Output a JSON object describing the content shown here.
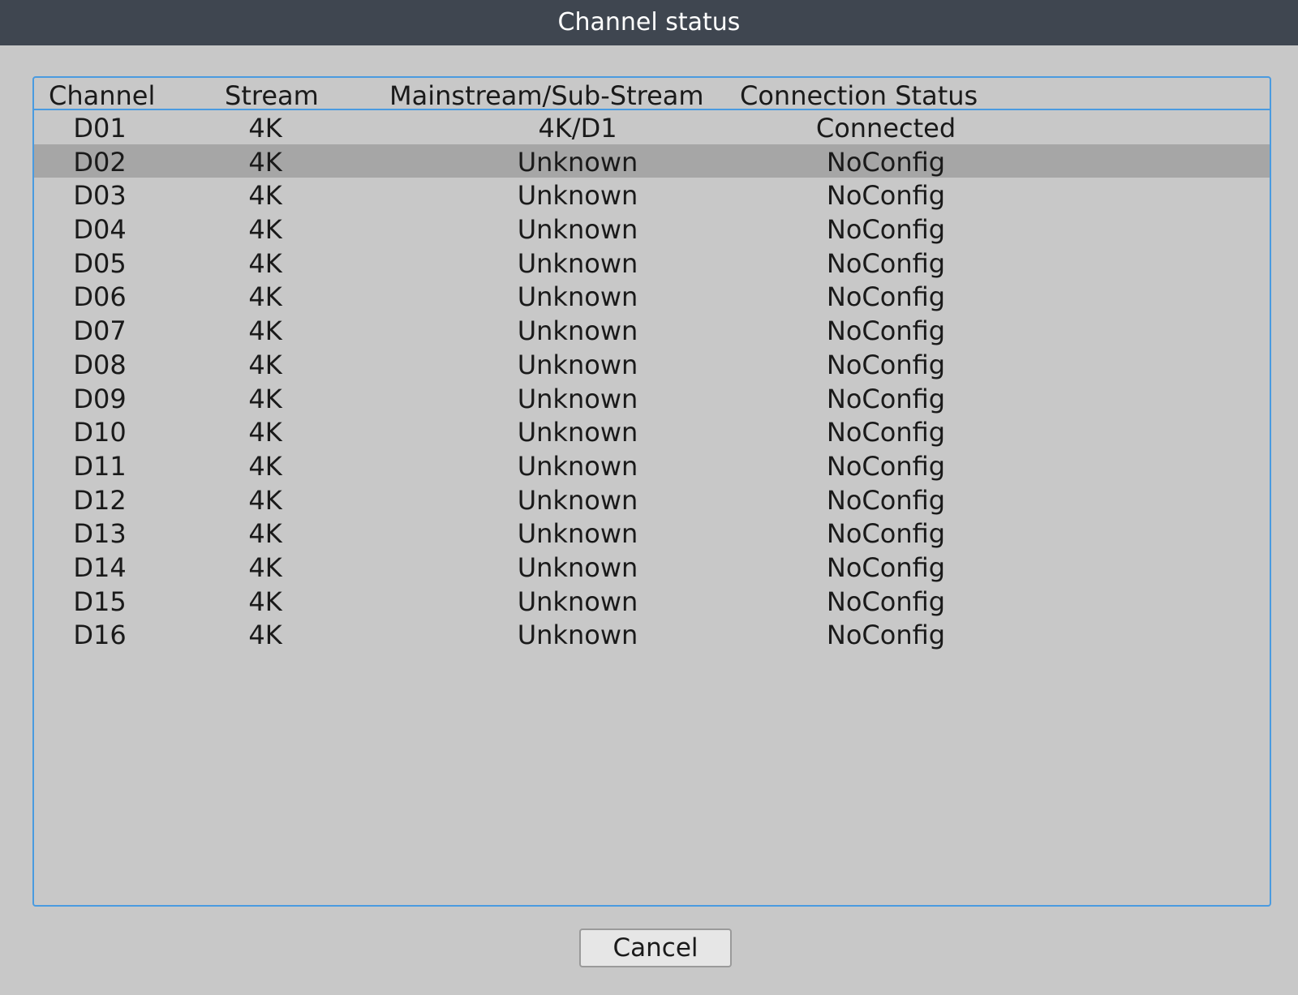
{
  "window": {
    "title": "Channel status"
  },
  "table": {
    "columns": {
      "channel": "Channel",
      "stream": "Stream",
      "mainstream_sub": "Mainstream/Sub-Stream",
      "connection_status": "Connection Status"
    },
    "selected_row": 1,
    "rows": [
      {
        "channel": "D01",
        "stream": "4K",
        "mainstream_sub": "4K/D1",
        "connection_status": "Connected"
      },
      {
        "channel": "D02",
        "stream": "4K",
        "mainstream_sub": "Unknown",
        "connection_status": "NoConfig"
      },
      {
        "channel": "D03",
        "stream": "4K",
        "mainstream_sub": "Unknown",
        "connection_status": "NoConfig"
      },
      {
        "channel": "D04",
        "stream": "4K",
        "mainstream_sub": "Unknown",
        "connection_status": "NoConfig"
      },
      {
        "channel": "D05",
        "stream": "4K",
        "mainstream_sub": "Unknown",
        "connection_status": "NoConfig"
      },
      {
        "channel": "D06",
        "stream": "4K",
        "mainstream_sub": "Unknown",
        "connection_status": "NoConfig"
      },
      {
        "channel": "D07",
        "stream": "4K",
        "mainstream_sub": "Unknown",
        "connection_status": "NoConfig"
      },
      {
        "channel": "D08",
        "stream": "4K",
        "mainstream_sub": "Unknown",
        "connection_status": "NoConfig"
      },
      {
        "channel": "D09",
        "stream": "4K",
        "mainstream_sub": "Unknown",
        "connection_status": "NoConfig"
      },
      {
        "channel": "D10",
        "stream": "4K",
        "mainstream_sub": "Unknown",
        "connection_status": "NoConfig"
      },
      {
        "channel": "D11",
        "stream": "4K",
        "mainstream_sub": "Unknown",
        "connection_status": "NoConfig"
      },
      {
        "channel": "D12",
        "stream": "4K",
        "mainstream_sub": "Unknown",
        "connection_status": "NoConfig"
      },
      {
        "channel": "D13",
        "stream": "4K",
        "mainstream_sub": "Unknown",
        "connection_status": "NoConfig"
      },
      {
        "channel": "D14",
        "stream": "4K",
        "mainstream_sub": "Unknown",
        "connection_status": "NoConfig"
      },
      {
        "channel": "D15",
        "stream": "4K",
        "mainstream_sub": "Unknown",
        "connection_status": "NoConfig"
      },
      {
        "channel": "D16",
        "stream": "4K",
        "mainstream_sub": "Unknown",
        "connection_status": "NoConfig"
      }
    ]
  },
  "footer": {
    "cancel_label": "Cancel"
  },
  "colors": {
    "titlebar_bg": "#3f4650",
    "panel_bg": "#c8c8c8",
    "border_accent": "#4a9be0",
    "selected_row_bg": "#a6a6a6"
  }
}
